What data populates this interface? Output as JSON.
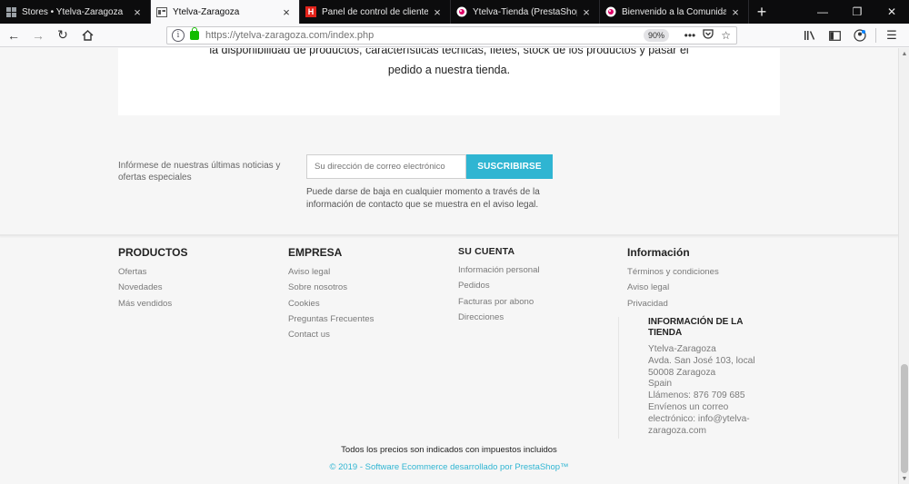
{
  "tabs": [
    {
      "title": "Stores • Ytelva-Zaragoza",
      "favicon": "grid-icon",
      "active": false
    },
    {
      "title": "Ytelva-Zaragoza",
      "favicon": "shop-icon",
      "active": true
    },
    {
      "title": "Panel de control de cliente",
      "favicon": "h-logo-icon",
      "active": false
    },
    {
      "title": "Ytelva-Tienda (PrestaShop™)",
      "favicon": "prestashop-icon",
      "active": false
    },
    {
      "title": "Bienvenido a la Comunidad de",
      "favicon": "prestashop-icon",
      "active": false
    }
  ],
  "navbar": {
    "url_host": "https://ytelva-zaragoza.com",
    "url_path": "/index.php",
    "zoom": "90%"
  },
  "card": {
    "line1": "la disponibilidad de productos, características técnicas, fletes, stock de los productos y pasar el",
    "line2": "pedido a nuestra tienda."
  },
  "newsletter": {
    "label": "Infórmese de nuestras últimas noticias y ofertas especiales",
    "placeholder": "Su dirección de correo electrónico",
    "button": "SUSCRIBIRSE",
    "note": "Puede darse de baja en cualquier momento a través de la información de contacto que se muestra en el aviso legal."
  },
  "footer": {
    "productos": {
      "title": "PRODUCTOS",
      "links": [
        "Ofertas",
        "Novedades",
        "Más vendidos"
      ]
    },
    "empresa": {
      "title": "EMPRESA",
      "links": [
        "Aviso legal",
        "Sobre nosotros",
        "Cookies",
        "Preguntas Frecuentes",
        "Contact us"
      ]
    },
    "cuenta": {
      "title": "SU CUENTA",
      "links": [
        "Información personal",
        "Pedidos",
        "Facturas por abono",
        "Direcciones"
      ]
    },
    "info": {
      "title": "Información",
      "links": [
        "Términos y condiciones",
        "Aviso legal",
        "Privacidad"
      ]
    },
    "store": {
      "title": "INFORMACIÓN DE LA TIENDA",
      "lines": [
        "Ytelva-Zaragoza",
        "Avda. San José 103, local",
        "50008 Zaragoza",
        "Spain",
        "Llámenos: 876 709 685",
        "Envíenos un correo",
        "electrónico: info@ytelva-",
        "zaragoza.com"
      ]
    },
    "prices_note": "Todos los precios son indicados con impuestos incluidos",
    "copyright": "© 2019 - Software Ecommerce desarrollado por PrestaShop™"
  },
  "colors": {
    "accent": "#2fb5d2",
    "tabbar": "#0c0c0d"
  }
}
